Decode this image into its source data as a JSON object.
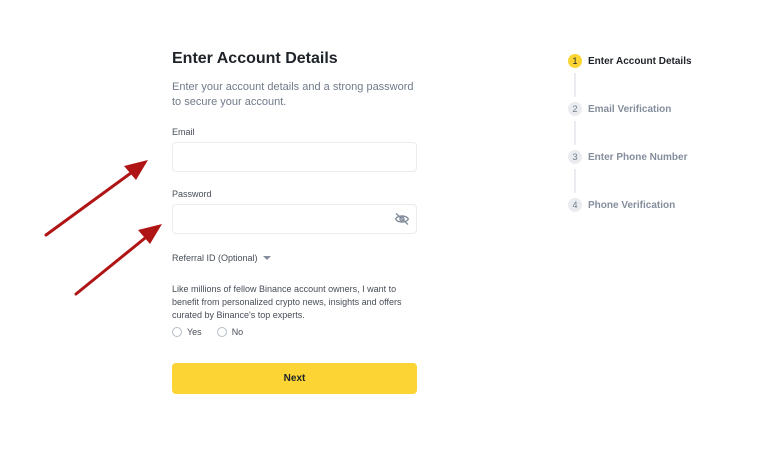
{
  "form": {
    "title": "Enter Account Details",
    "subtitle": "Enter your account details and a strong password to secure your account.",
    "email": {
      "label": "Email",
      "value": "",
      "placeholder": ""
    },
    "password": {
      "label": "Password",
      "value": "",
      "placeholder": "",
      "toggle_icon": "eye-hidden-icon"
    },
    "referral": {
      "label": "Referral ID (Optional)",
      "icon": "caret-down-icon"
    },
    "consent": {
      "text": "Like millions of fellow Binance account owners, I want to benefit from personalized crypto news, insights and offers curated by Binance's top experts.",
      "options": [
        "Yes",
        "No"
      ]
    },
    "next_label": "Next"
  },
  "stepper": {
    "steps": [
      {
        "number": "1",
        "label": "Enter Account Details",
        "active": true
      },
      {
        "number": "2",
        "label": "Email Verification",
        "active": false
      },
      {
        "number": "3",
        "label": "Enter Phone Number",
        "active": false
      },
      {
        "number": "4",
        "label": "Phone Verification",
        "active": false
      }
    ]
  },
  "annotations": {
    "arrow_color": "#b01515",
    "arrows": [
      "arrow-to-email-icon",
      "arrow-to-password-icon"
    ]
  },
  "colors": {
    "accent": "#fcd535",
    "text_primary": "#1e2329",
    "text_secondary": "#707a8a",
    "border": "#eaecef"
  }
}
